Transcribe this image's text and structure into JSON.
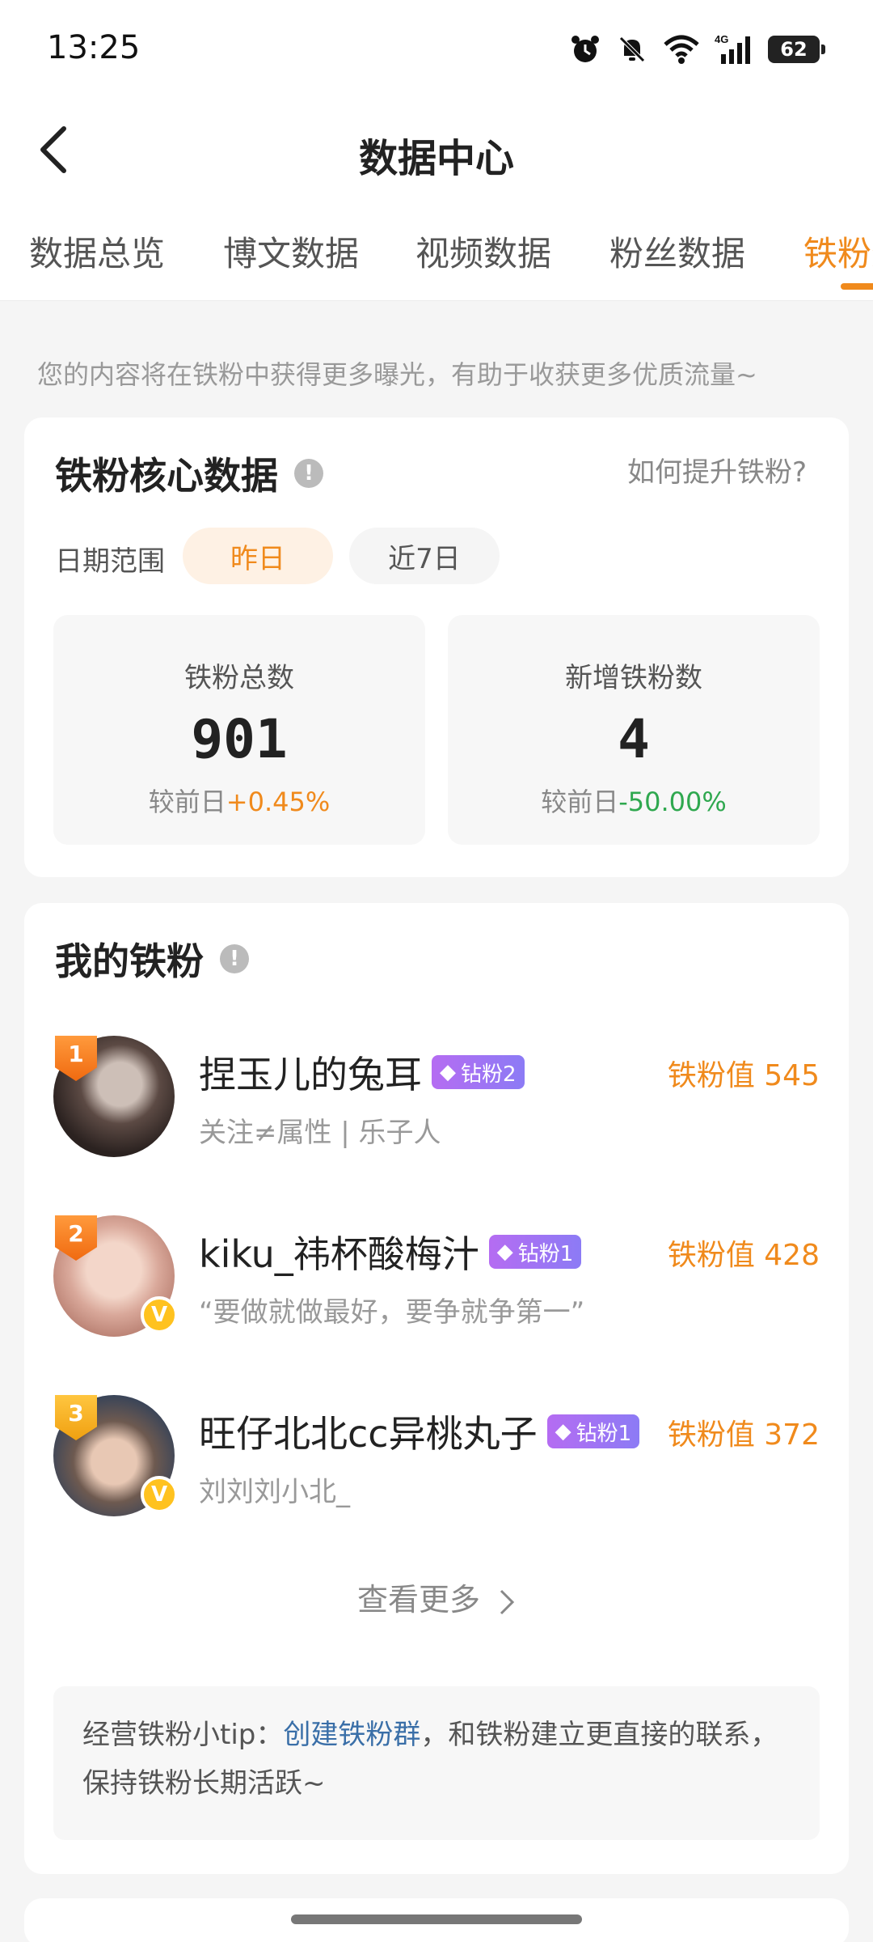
{
  "status_bar": {
    "time": "13:25",
    "icons": [
      "alarm-icon",
      "mute-bell-icon",
      "wifi-icon",
      "4g-signal-icon",
      "battery-icon"
    ],
    "network": "4G",
    "battery": "62"
  },
  "nav": {
    "title": "数据中心"
  },
  "tabs": [
    {
      "label": "数据总览",
      "active": false
    },
    {
      "label": "博文数据",
      "active": false
    },
    {
      "label": "视频数据",
      "active": false
    },
    {
      "label": "粉丝数据",
      "active": false
    },
    {
      "label": "铁粉数",
      "active": true
    }
  ],
  "intro": "您的内容将在铁粉中获得更多曝光，有助于收获更多优质流量~",
  "core": {
    "title": "铁粉核心数据",
    "help_link": "如何提升铁粉?",
    "date_label": "日期范围",
    "range_options": [
      "昨日",
      "近7日"
    ],
    "selected_range": "昨日",
    "stats": [
      {
        "label": "铁粉总数",
        "value": "901",
        "compare_prefix": "较前日",
        "change": "+0.45%",
        "direction": "up"
      },
      {
        "label": "新增铁粉数",
        "value": "4",
        "compare_prefix": "较前日",
        "change": "-50.00%",
        "direction": "down"
      }
    ],
    "colors": {
      "up": "#f08a1c",
      "down": "#2fa84f"
    }
  },
  "fans": {
    "title": "我的铁粉",
    "list": [
      {
        "rank": "1",
        "name": "捏玉儿的兔耳",
        "level": "钻粉2",
        "desc": "关注≠属性 | 乐子人",
        "value": "铁粉值 545",
        "verified": false
      },
      {
        "rank": "2",
        "name": "kiku_祎杯酸梅汁",
        "level": "钻粉1",
        "desc": "“要做就做最好，要争就争第一”",
        "value": "铁粉值 428",
        "verified": true
      },
      {
        "rank": "3",
        "name": "旺仔北北cc异桃丸子",
        "level": "钻粉1",
        "desc": "刘刘刘小北_",
        "value": "铁粉值 372",
        "verified": true
      }
    ],
    "more_label": "查看更多",
    "tip_prefix": "经营铁粉小tip：",
    "tip_link": "创建铁粉群",
    "tip_suffix": "，和铁粉建立更直接的联系，保持铁粉长期活跃~"
  },
  "theme": {
    "accent": "#f08a1c",
    "link": "#3a6fa8"
  }
}
